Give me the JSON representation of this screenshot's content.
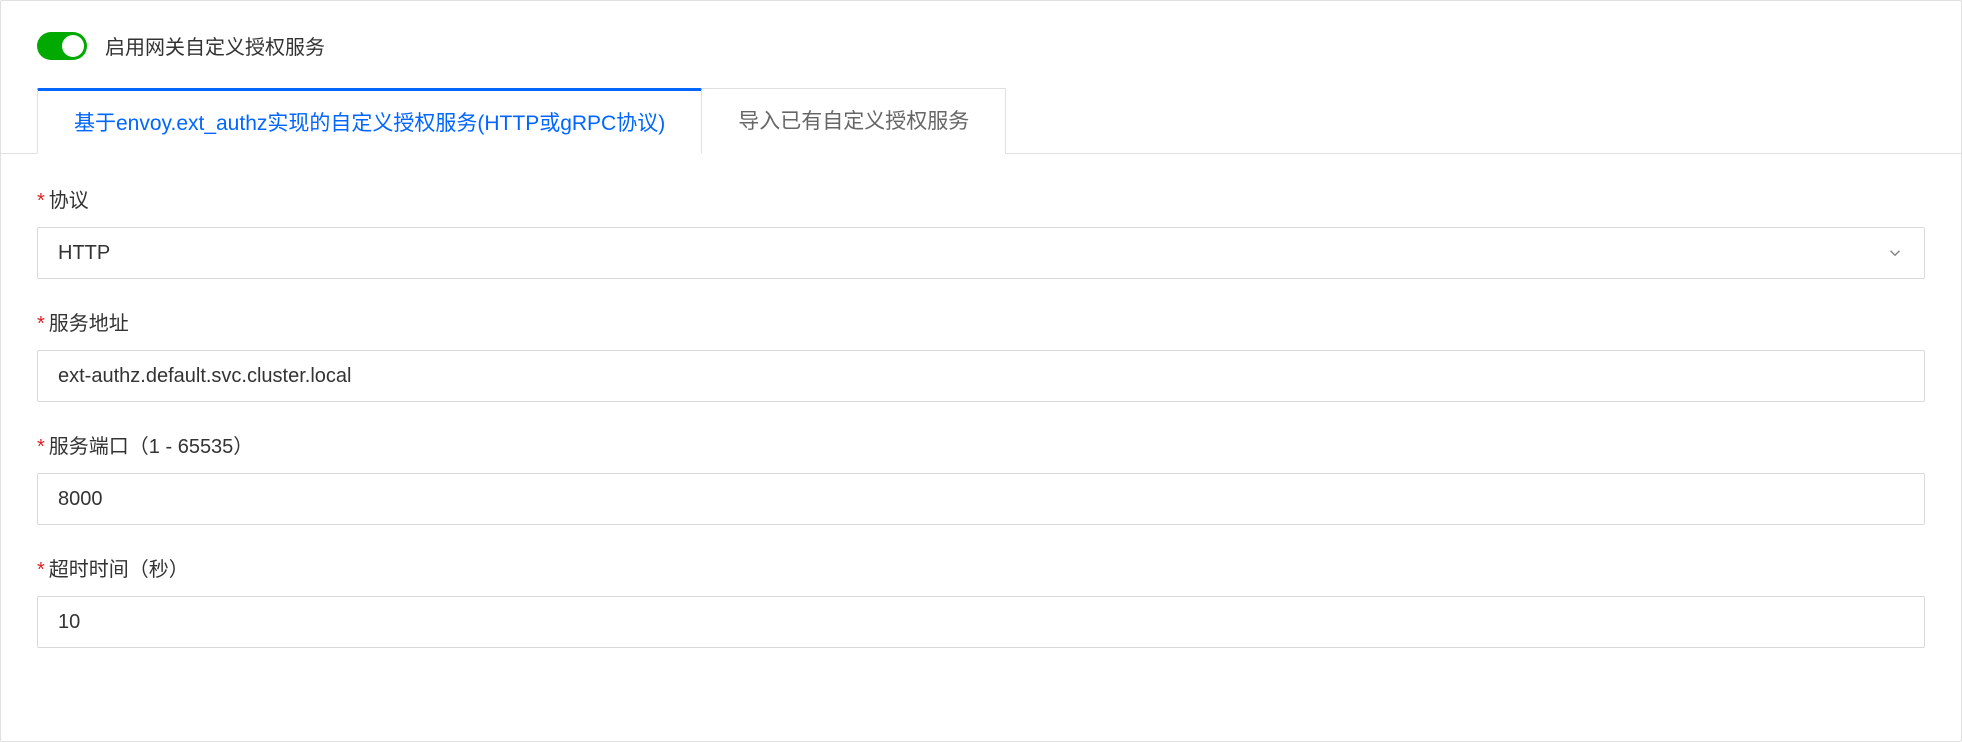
{
  "toggle": {
    "enabled": true,
    "label": "启用网关自定义授权服务"
  },
  "tabs": {
    "active": "基于envoy.ext_authz实现的自定义授权服务(HTTP或gRPC协议)",
    "inactive": "导入已有自定义授权服务"
  },
  "form": {
    "protocol": {
      "label": "协议",
      "value": "HTTP"
    },
    "serviceAddress": {
      "label": "服务地址",
      "value": "ext-authz.default.svc.cluster.local"
    },
    "servicePort": {
      "label": "服务端口（1 - 65535）",
      "value": "8000"
    },
    "timeout": {
      "label": "超时时间（秒）",
      "value": "10"
    }
  }
}
